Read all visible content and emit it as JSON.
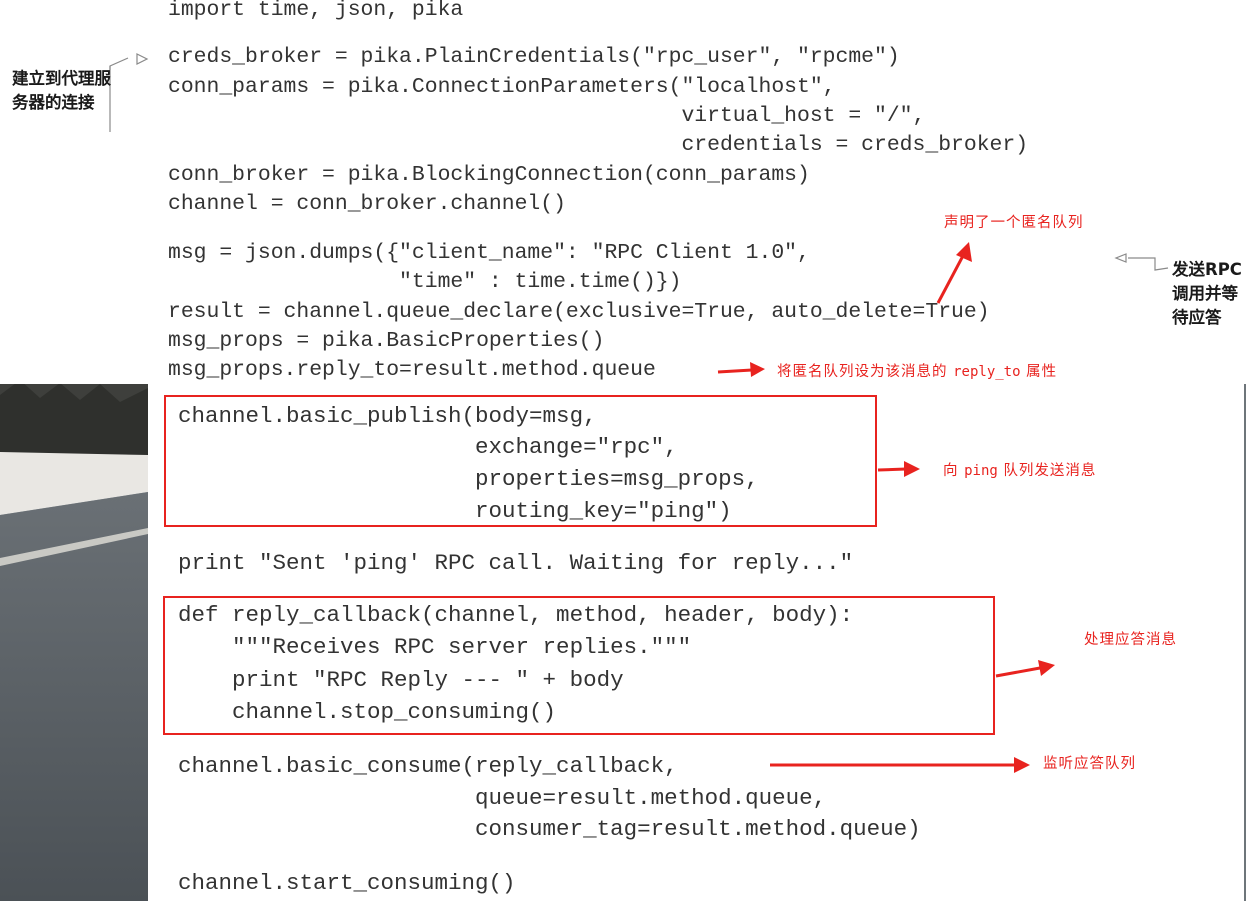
{
  "code": {
    "l01": "import time, json, pika",
    "l02": "creds_broker = pika.PlainCredentials(\"rpc_user\", \"rpcme\")",
    "l03": "conn_params = pika.ConnectionParameters(\"localhost\",",
    "l04": "                                        virtual_host = \"/\",",
    "l05": "                                        credentials = creds_broker)",
    "l06": "conn_broker = pika.BlockingConnection(conn_params)",
    "l07": "channel = conn_broker.channel()",
    "l08": "msg = json.dumps({\"client_name\": \"RPC Client 1.0\",",
    "l09": "                  \"time\" : time.time()})",
    "l10": "result = channel.queue_declare(exclusive=True, auto_delete=True)",
    "l11": "msg_props = pika.BasicProperties()",
    "l12": "msg_props.reply_to=result.method.queue",
    "l13": "channel.basic_publish(body=msg,",
    "l14": "                      exchange=\"rpc\",",
    "l15": "                      properties=msg_props,",
    "l16": "                      routing_key=\"ping\")",
    "l17": "print \"Sent 'ping' RPC call. Waiting for reply...\"",
    "l18": "def reply_callback(channel, method, header, body):",
    "l19": "    \"\"\"Receives RPC server replies.\"\"\"",
    "l20": "    print \"RPC Reply --- \" + body",
    "l21": "    channel.stop_consuming()",
    "l22": "channel.basic_consume(reply_callback,",
    "l23": "                      queue=result.method.queue,",
    "l24": "                      consumer_tag=result.method.queue)",
    "l25": "channel.start_consuming()"
  },
  "annotations": {
    "connect_broker": "建立到代理服务器的连接",
    "declare_anon_queue": "声明了一个匿名队列",
    "send_rpc": "发送RPC调用并等待应答",
    "reply_to_pre": "将匿名队列设为该消息的",
    "reply_to_code": "reply_to",
    "reply_to_post": "属性",
    "send_ping_pre": "向",
    "send_ping_code": "ping",
    "send_ping_post": "队列发送消息",
    "handle_reply": "处理应答消息",
    "listen_reply": "监听应答队列"
  },
  "colors": {
    "annotation_red": "#e8231f",
    "code_text": "#333333",
    "panel": "#ffffff"
  },
  "icons": {
    "callout_arrow": "hollow-triangle-arrow-icon",
    "pointer_arrow": "red-arrow-icon"
  }
}
